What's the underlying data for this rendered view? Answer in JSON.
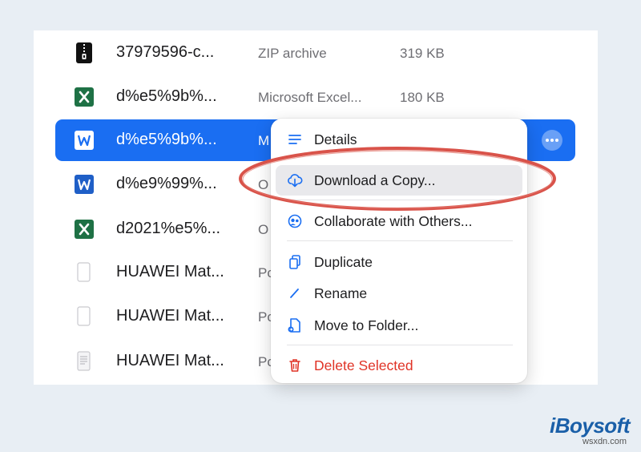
{
  "files": [
    {
      "name": "37979596-c...",
      "kind": "ZIP archive",
      "size": "319 KB",
      "icon": "zip-icon"
    },
    {
      "name": "d%e5%9b%...",
      "kind": "Microsoft Excel...",
      "size": "180 KB",
      "icon": "excel-icon"
    },
    {
      "name": "d%e5%9b%...",
      "kind": "M",
      "size": "",
      "icon": "word-icon",
      "selected": true
    },
    {
      "name": "d%e9%99%...",
      "kind": "O",
      "size": "",
      "icon": "word-icon"
    },
    {
      "name": "d2021%e5%...",
      "kind": "O",
      "size": "",
      "icon": "excel-icon"
    },
    {
      "name": "HUAWEI Mat...",
      "kind": "Po",
      "size": "",
      "icon": "blank-document-icon"
    },
    {
      "name": "HUAWEI Mat...",
      "kind": "Po",
      "size": "",
      "icon": "blank-document-icon"
    },
    {
      "name": "HUAWEI Mat...",
      "kind": "Po",
      "size": "",
      "icon": "text-document-icon"
    }
  ],
  "context_menu": {
    "items": [
      {
        "label": "Details",
        "icon": "list-icon"
      },
      {
        "label": "Download a Copy...",
        "icon": "cloud-download-icon",
        "highlighted": true
      },
      {
        "label": "Collaborate with Others...",
        "icon": "collaborate-icon"
      },
      {
        "label": "Duplicate",
        "icon": "duplicate-icon"
      },
      {
        "label": "Rename",
        "icon": "pencil-icon"
      },
      {
        "label": "Move to Folder...",
        "icon": "move-folder-icon"
      },
      {
        "label": "Delete Selected",
        "icon": "trash-icon",
        "danger": true
      }
    ]
  },
  "watermark": {
    "brand": "iBoysoft",
    "site": "wsxdn.com"
  },
  "colors": {
    "selection": "#1a6ef2",
    "highlight_oval": "#d9534a",
    "menu_accent": "#1a6ef2",
    "danger": "#e03326",
    "excel_green": "#1e7145",
    "word_blue": "#1f5fc7"
  }
}
